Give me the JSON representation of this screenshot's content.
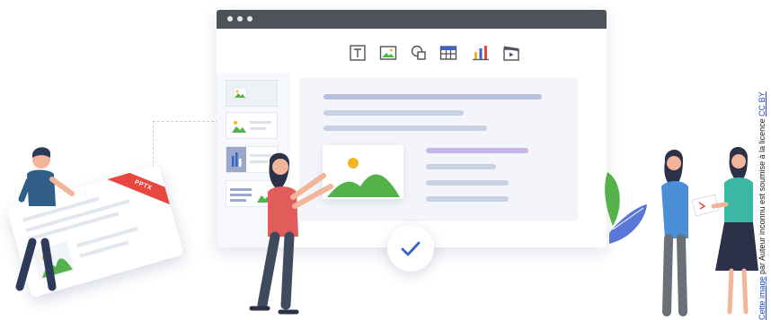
{
  "pptx_card": {
    "badge_label": "PPTX"
  },
  "toolbar": {
    "icons": [
      "text-box-icon",
      "image-icon",
      "shapes-icon",
      "table-icon",
      "chart-icon",
      "video-icon"
    ]
  },
  "credit": {
    "link_start": "Cette image",
    "middle": " par Auteur inconnu est soumise à la licence ",
    "link_end": "CC BY"
  },
  "colors": {
    "titlebar": "#4d5358",
    "accent_blue": "#3a63c9",
    "green": "#53b34a",
    "yellow": "#f3b61f",
    "pptx_red": "#e8463f"
  }
}
